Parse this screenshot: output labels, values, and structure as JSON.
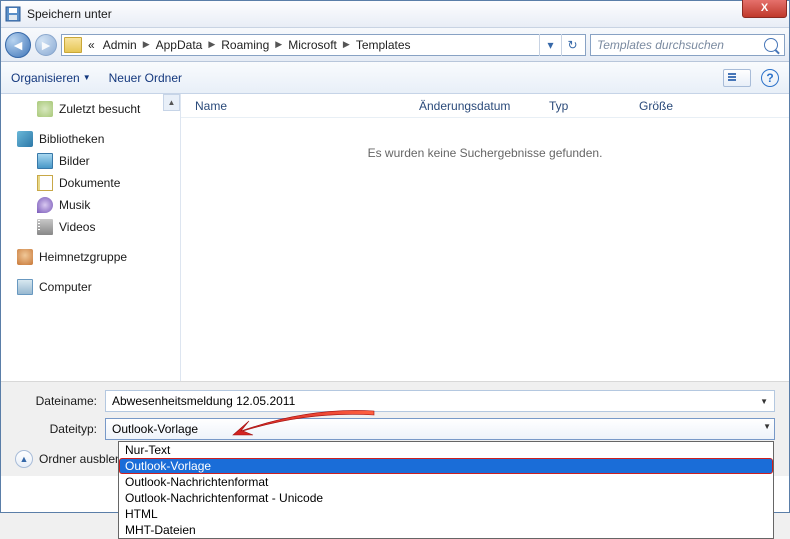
{
  "window": {
    "title": "Speichern unter",
    "close": "X"
  },
  "nav": {
    "crumbs_prefix": "«",
    "crumbs": [
      "Admin",
      "AppData",
      "Roaming",
      "Microsoft",
      "Templates"
    ],
    "search_placeholder": "Templates durchsuchen"
  },
  "toolbar": {
    "organize": "Organisieren",
    "new_folder": "Neuer Ordner"
  },
  "sidebar": {
    "recent": "Zuletzt besucht",
    "libraries": "Bibliotheken",
    "pictures": "Bilder",
    "documents": "Dokumente",
    "music": "Musik",
    "videos": "Videos",
    "homegroup": "Heimnetzgruppe",
    "computer": "Computer"
  },
  "columns": {
    "name": "Name",
    "date": "Änderungsdatum",
    "type": "Typ",
    "size": "Größe"
  },
  "content": {
    "empty": "Es wurden keine Suchergebnisse gefunden."
  },
  "save": {
    "filename_label": "Dateiname:",
    "filename_value": "Abwesenheitsmeldung 12.05.2011",
    "filetype_label": "Dateityp:",
    "filetype_value": "Outlook-Vorlage",
    "options": [
      "Nur-Text",
      "Outlook-Vorlage",
      "Outlook-Nachrichtenformat",
      "Outlook-Nachrichtenformat - Unicode",
      "HTML",
      "MHT-Dateien"
    ],
    "hide_folders": "Ordner ausblende"
  }
}
